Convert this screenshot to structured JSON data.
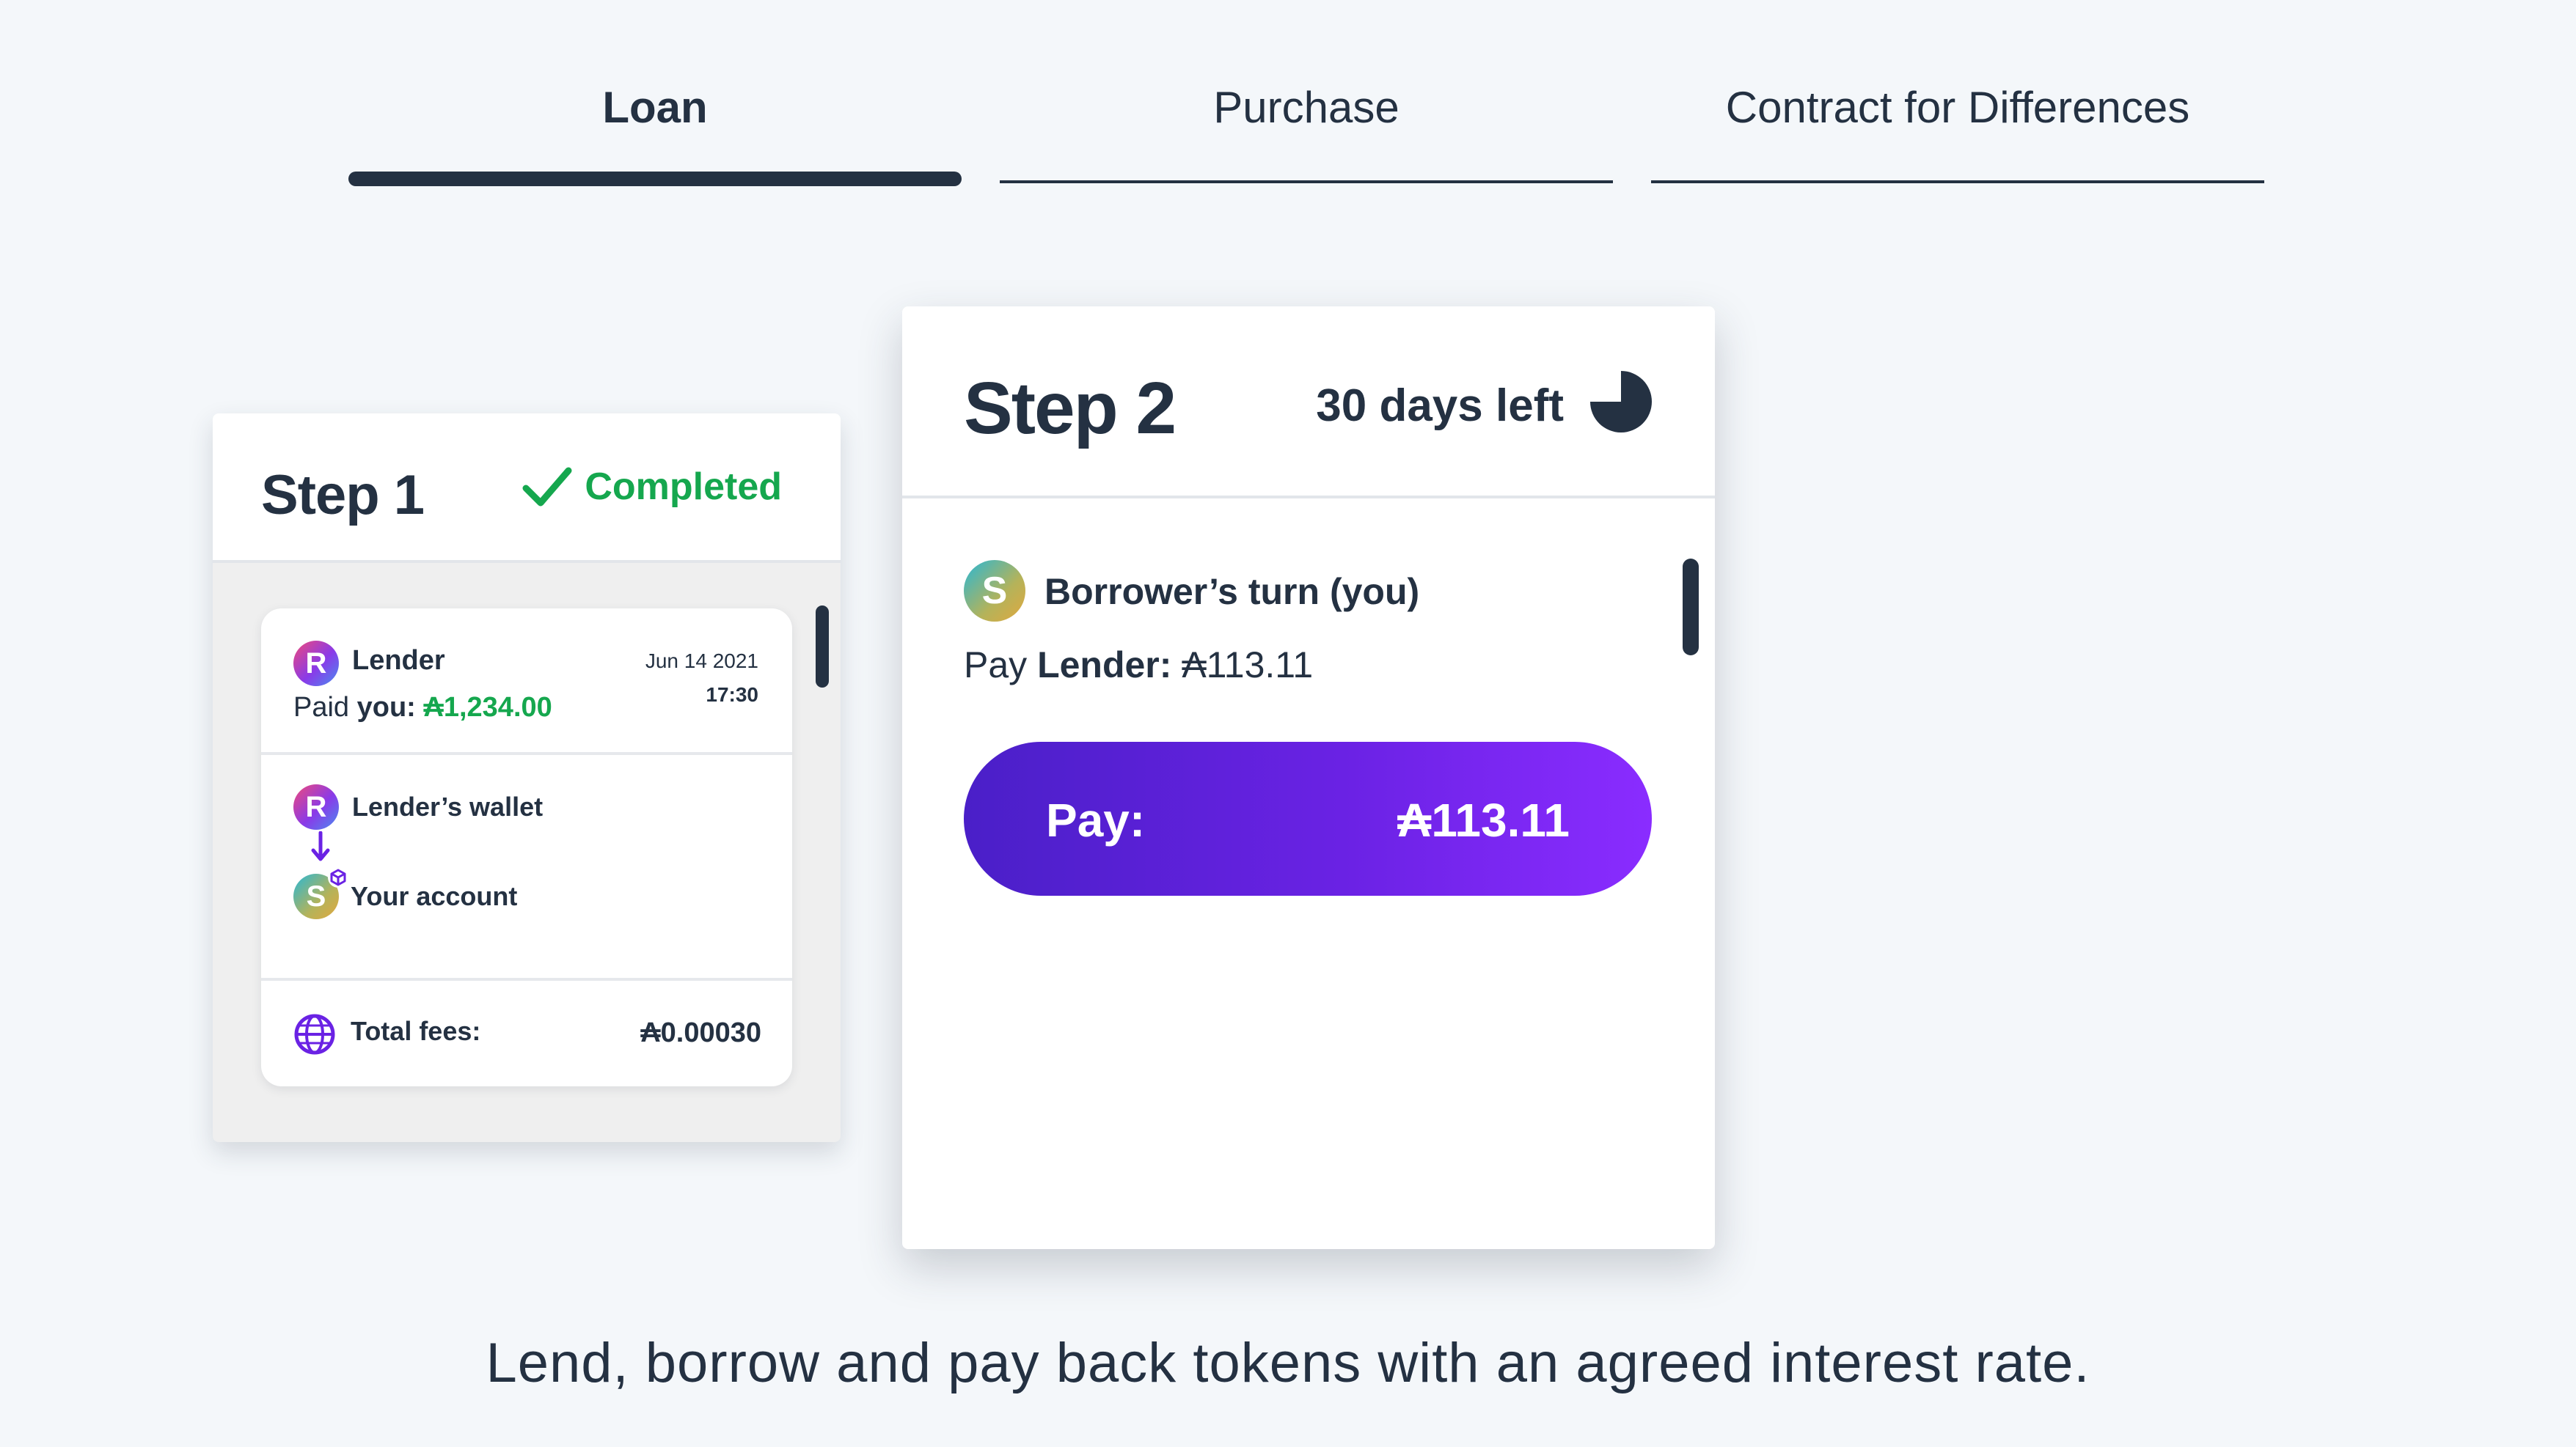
{
  "tabs": [
    {
      "label": "Loan",
      "active": true
    },
    {
      "label": "Purchase",
      "active": false
    },
    {
      "label": "Contract for Differences",
      "active": false
    }
  ],
  "step1": {
    "title": "Step 1",
    "status": "Completed",
    "status_icon": "check-icon",
    "status_color": "#15a74e",
    "lender": {
      "avatar": "R",
      "name": "Lender",
      "paid_prefix": "Paid ",
      "paid_you": "you:",
      "amount": "₳1,234.00",
      "date": "Jun 14 2021",
      "time": "17:30"
    },
    "transfer": {
      "from_avatar": "R",
      "from": "Lender’s wallet",
      "to_avatar": "S",
      "to": "Your account"
    },
    "fees": {
      "label": "Total fees:",
      "value": "₳0.00030",
      "icon": "globe-icon"
    }
  },
  "step2": {
    "title": "Step 2",
    "days_left": "30 days left",
    "timer_icon": "pie-timer-icon",
    "turn_avatar": "S",
    "turn": "Borrower’s turn (you)",
    "pay_prefix": "Pay ",
    "pay_target": "Lender:",
    "pay_amount": " ₳113.11",
    "button_label": "Pay:",
    "button_amount": "₳113.11",
    "button_colors": [
      "#4a1fc8",
      "#8a2cff"
    ]
  },
  "caption": "Lend, borrow and pay back tokens with an agreed interest rate.",
  "colors": {
    "text": "#243142",
    "background": "#f4f7fa",
    "success": "#15a74e",
    "accent": "#6a22e4"
  }
}
